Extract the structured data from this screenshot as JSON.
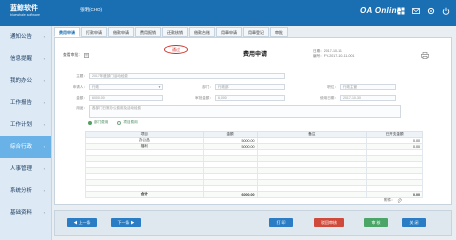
{
  "header": {
    "logo_main": "蓝鲸软件",
    "logo_sub": "bluewhale software",
    "user": "张明(CHO)",
    "brand": "OA  Online",
    "icons": [
      "grid-icon",
      "mail-icon",
      "settings-icon",
      "power-icon"
    ]
  },
  "sidebar": {
    "items": [
      {
        "label": "通知公告"
      },
      {
        "label": "信息提醒"
      },
      {
        "label": "我的办公"
      },
      {
        "label": "工作报告"
      },
      {
        "label": "工作计划"
      },
      {
        "label": "综合行政",
        "active": true
      },
      {
        "label": "人事管理"
      },
      {
        "label": "系统分析"
      },
      {
        "label": "基础资料"
      }
    ]
  },
  "tabs": [
    "费用申请",
    "打款申请",
    "借款申请",
    "费用报销",
    "还款核销",
    "借款台账",
    "用章申请",
    "用章登记",
    "审批"
  ],
  "form": {
    "title": "费用申请",
    "stamp": "通过",
    "approver_label": "查看审批：",
    "meta_date": "日期：2017-10-11",
    "meta_no": "编号：FY-2017-10-11-001",
    "fields": {
      "subject_label": "主题：",
      "subject_value": "2017年度部门活动经费",
      "applicant_label": "申请人：",
      "applicant_value": "行政",
      "dept_label": "部门：",
      "dept_value": "行政部",
      "role_label": "职位：",
      "role_value": "行政主管",
      "amount_label": "金额：",
      "amount_value": "6000.00",
      "approved_label": "审批金额：",
      "approved_value": "6,000",
      "date_label": "使用日期：",
      "date_value": "2017-10-30",
      "usage_label": "用途：",
      "usage_value": "各部门日常办公费用及活动经费"
    },
    "radios": [
      "部门费用",
      "项目费用"
    ]
  },
  "table": {
    "headers": [
      "项目",
      "金额",
      "备注",
      "已开支金额"
    ],
    "rows": [
      {
        "item": "办公品",
        "amount": "5000.00",
        "remark": "",
        "spent": "0.00"
      },
      {
        "item": "福利",
        "amount": "5000.00",
        "remark": "",
        "spent": "0.00"
      },
      {
        "item": "",
        "amount": "",
        "remark": "",
        "spent": ""
      },
      {
        "item": "",
        "amount": "",
        "remark": "",
        "spent": ""
      },
      {
        "item": "",
        "amount": "",
        "remark": "",
        "spent": ""
      },
      {
        "item": "",
        "amount": "",
        "remark": "",
        "spent": ""
      },
      {
        "item": "",
        "amount": "",
        "remark": "",
        "spent": ""
      },
      {
        "item": "",
        "amount": "",
        "remark": "",
        "spent": ""
      },
      {
        "item": "",
        "amount": "",
        "remark": "",
        "spent": ""
      }
    ],
    "total_label": "合计",
    "total_amount": "6000.00",
    "total_spent": "0.00"
  },
  "attachment_label": "附件：",
  "footer": {
    "prev": "上一条",
    "next": "下一条",
    "print": "打 印",
    "reject": "驳回审核",
    "approve": "审 核",
    "close": "关 闭"
  }
}
